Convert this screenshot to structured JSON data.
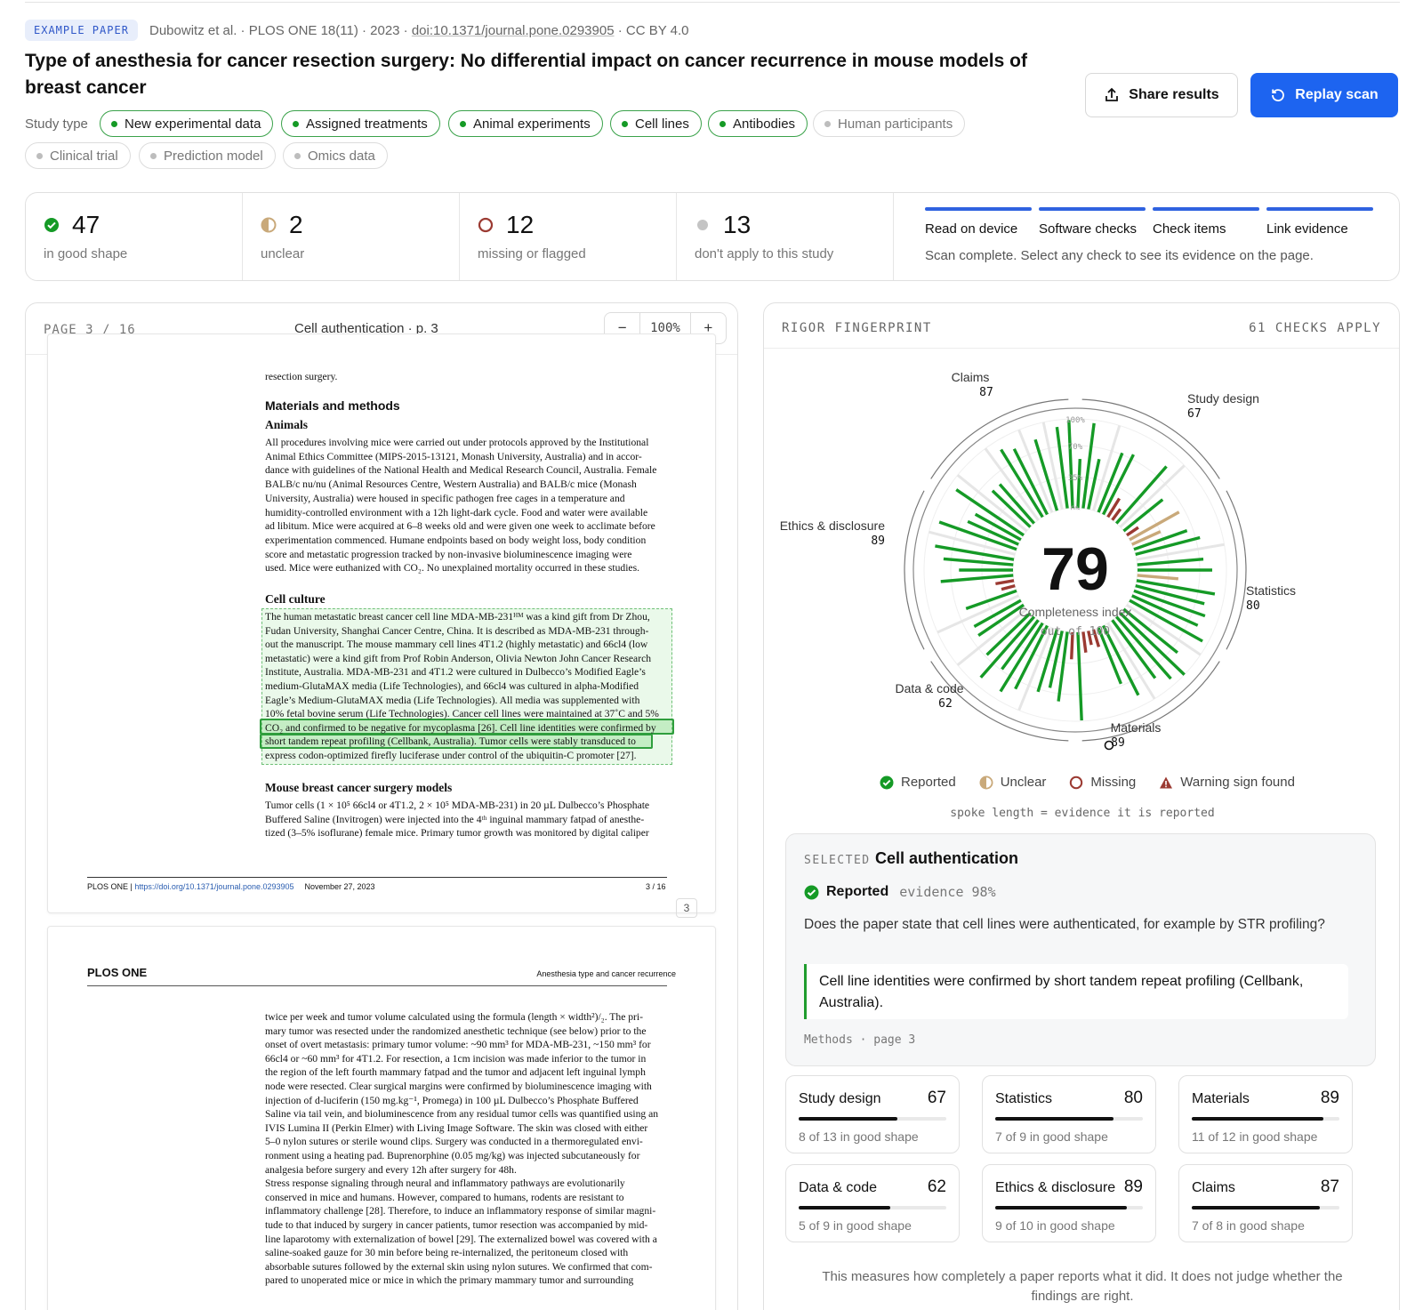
{
  "header": {
    "badge": "EXAMPLE PAPER",
    "meta_prefix": "Dubowitz et al. · PLOS ONE 18(11) · 2023 · ",
    "doi": "doi:10.1371/journal.pone.0293905",
    "meta_suffix": " · CC BY 4.0",
    "title": "Type of anesthesia for cancer resection surgery: No differential impact on cancer recurrence in mouse models of breast cancer",
    "share_label": "Share results",
    "replay_label": "Replay scan",
    "study_type_label": "Study type",
    "chips": [
      {
        "label": "New experimental data",
        "active": true
      },
      {
        "label": "Assigned treatments",
        "active": true
      },
      {
        "label": "Animal experiments",
        "active": true
      },
      {
        "label": "Cell lines",
        "active": true
      },
      {
        "label": "Antibodies",
        "active": true
      },
      {
        "label": "Human participants",
        "active": false
      },
      {
        "label": "Clinical trial",
        "active": false
      },
      {
        "label": "Prediction model",
        "active": false
      },
      {
        "label": "Omics data",
        "active": false
      }
    ]
  },
  "summary": {
    "good": {
      "value": "47",
      "label": "in good shape"
    },
    "unclear": {
      "value": "2",
      "label": "unclear"
    },
    "missing": {
      "value": "12",
      "label": "missing or flagged"
    },
    "na": {
      "value": "13",
      "label": "don't apply to this study"
    },
    "tabs": [
      "Read on device",
      "Software checks",
      "Check items",
      "Link evidence"
    ],
    "message": "Scan complete. Select any check to see its evidence on the page."
  },
  "viewer": {
    "page_indicator": "PAGE 3 / 16",
    "page_title": "Cell authentication · p. 3",
    "zoom_minus": "−",
    "zoom_value": "100%",
    "zoom_plus": "+",
    "page3": {
      "top_fragment": "resection surgery.",
      "h_methods": "Materials and methods",
      "h_animals": "Animals",
      "animals_lines": [
        "All procedures involving mice were carried out under protocols approved by the Institutional",
        "Animal Ethics Committee (MIPS-2015-13121, Monash University, Australia) and in accor-",
        "dance with guidelines of the National Health and Medical Research Council, Australia. Female",
        "BALB/c nu/nu (Animal Resources Centre, Western Australia) and BALB/c mice (Monash",
        "University, Australia) were housed in specific pathogen free cages in a temperature and",
        "humidity-controlled environment with a 12h light-dark cycle. Food and water were available",
        "ad libitum. Mice were acquired at 6–8 weeks old and were given one week to acclimate before",
        "experimentation commenced. Humane endpoints based on body weight loss, body condition",
        "score and metastatic progression tracked by non-invasive bioluminescence imaging were",
        "used. Mice were euthanized with CO₂. No unexplained mortality occurred in these studies."
      ],
      "h_culture": "Cell culture",
      "culture_lines": [
        "The human metastatic breast cancer cell line MDA-MB-231ᴴᴹ was a kind gift from Dr Zhou,",
        "Fudan University, Shanghai Cancer Centre, China. It is described as MDA-MB-231 through-",
        "out the manuscript. The mouse mammary cell lines 4T1.2 (highly metastatic) and 66cl4 (low",
        "metastatic) were a kind gift from Prof Robin Anderson, Olivia Newton John Cancer Research",
        "Institute, Australia. MDA-MB-231 and 4T1.2 were cultured in Dulbecco’s Modified Eagle’s",
        "medium-GlutaMAX media (Life Technologies), and 66cl4 was cultured in alpha-Modified",
        "Eagle’s Medium-GlutaMAX media (Life Technologies). All media was supplemented with",
        "10% fetal bovine serum (Life Technologies). Cancer cell lines were maintained at 37˚C and 5%",
        "CO₂ and confirmed to be negative for mycoplasma [26]. Cell line identities were confirmed by",
        "short tandem repeat profiling (Cellbank, Australia). Tumor cells were stably transduced to",
        "express codon-optimized firefly luciferase under control of the ubiquitin-C promoter [27]."
      ],
      "h_surgery": "Mouse breast cancer surgery models",
      "surgery_lines": [
        "Tumor cells (1 × 10⁵ 66cl4 or 4T1.2, 2 × 10⁵ MDA-MB-231) in 20 µL Dulbecco’s Phosphate",
        "Buffered Saline (Invitrogen) were injected into the 4ᵗʰ inguinal mammary fatpad of anesthe-",
        "tized (3–5% isoflurane) female mice. Primary tumor growth was monitored by digital caliper"
      ],
      "footer_journal": "PLOS ONE | ",
      "footer_link": "https://doi.org/10.1371/journal.pone.0293905",
      "footer_date": "November 27, 2023",
      "footer_page": "3 / 16",
      "page_badge": "3"
    },
    "page4": {
      "journal": "PLOS ONE",
      "running_title": "Anesthesia type and cancer recurrence",
      "lines": [
        "twice per week and tumor volume calculated using the formula (length × width²)/₂. The pri-",
        "mary tumor was resected under the randomized anesthetic technique (see below) prior to the",
        "onset of overt metastasis: primary tumor volume: ~90 mm³ for MDA-MB-231, ~150 mm³ for",
        "66cl4 or ~60 mm³ for 4T1.2. For resection, a 1cm incision was made inferior to the tumor in",
        "the region of the left fourth mammary fatpad and the tumor and adjacent left inguinal lymph",
        "node were resected. Clear surgical margins were confirmed by bioluminescence imaging with",
        "injection of d-luciferin (150 mg.kg⁻¹, Promega) in 100 µL Dulbecco’s Phosphate Buffered",
        "Saline via tail vein, and bioluminescence from any residual tumor cells was quantified using an",
        "IVIS Lumina II (Perkin Elmer) with Living Image Software. The skin was closed with either",
        "5–0 nylon sutures or sterile wound clips. Surgery was conducted in a thermoregulated envi-",
        "ronment using a heating pad. Buprenorphine (0.05 mg/kg) was injected subcutaneously for",
        "analgesia before surgery and every 12h after surgery for 48h.",
        "    Stress response signaling through neural and inflammatory pathways are evolutionarily",
        "conserved in mice and humans. However, compared to humans, rodents are resistant to",
        "inflammatory challenge [28]. Therefore, to induce an inflammatory response of similar magni-",
        "tude to that induced by surgery in cancer patients, tumor resection was accompanied by mid-",
        "line laparotomy with externalization of bowel [29]. The externalized bowel was covered with a",
        "saline-soaked gauze for 30 min before being re-internalized, the peritoneum closed with",
        "absorbable sutures followed by the external skin using nylon sutures. We confirmed that com-",
        "pared to unoperated mice or mice in which the primary mammary tumor and surrounding"
      ]
    }
  },
  "fingerprint": {
    "title": "RIGOR FINGERPRINT",
    "checks_apply": "61 CHECKS APPLY",
    "index_value": "79",
    "index_label": "Completeness index",
    "index_sub": "out of 100",
    "ring_labels": [
      "100%",
      "70%",
      "35%",
      "0%"
    ],
    "categories": [
      {
        "name": "Claims",
        "score": "87",
        "detail": "7 of 8 in good shape",
        "fraction": 0.87
      },
      {
        "name": "Study design",
        "score": "67",
        "detail": "8 of 13 in good shape",
        "fraction": 0.67
      },
      {
        "name": "Statistics",
        "score": "80",
        "detail": "7 of 9 in good shape",
        "fraction": 0.8
      },
      {
        "name": "Materials",
        "score": "89",
        "detail": "11 of 12 in good shape",
        "fraction": 0.89
      },
      {
        "name": "Data & code",
        "score": "62",
        "detail": "5 of 9 in good shape",
        "fraction": 0.62
      },
      {
        "name": "Ethics & disclosure",
        "score": "89",
        "detail": "9 of 10 in good shape",
        "fraction": 0.89
      }
    ],
    "legend": [
      "Reported",
      "Unclear",
      "Missing",
      "Warning sign found"
    ],
    "spoke_note": "spoke length = evidence it is reported",
    "colors": {
      "reported": "#159a26",
      "unclear": "#c9a97a",
      "missing": "#9b3a32",
      "na": "#e6e6e6"
    }
  },
  "selected": {
    "label": "SELECTED",
    "name": "Cell authentication",
    "status": "Reported",
    "evidence": "evidence 98%",
    "question": "Does the paper state that cell lines were authenticated, for example by STR profiling?",
    "quote": "Cell line identities were confirmed by short tandem repeat profiling (Cellbank, Australia).",
    "location": "Methods · page 3"
  },
  "grid": {
    "order": [
      "Study design",
      "Statistics",
      "Materials",
      "Data & code",
      "Ethics & disclosure",
      "Claims"
    ],
    "cards": [
      {
        "name": "Study design",
        "score": "67",
        "detail": "8 of 13 in good shape",
        "fraction": 0.67
      },
      {
        "name": "Statistics",
        "score": "80",
        "detail": "7 of 9 in good shape",
        "fraction": 0.8
      },
      {
        "name": "Materials",
        "score": "89",
        "detail": "11 of 12 in good shape",
        "fraction": 0.89
      },
      {
        "name": "Data & code",
        "score": "62",
        "detail": "5 of 9 in good shape",
        "fraction": 0.62
      },
      {
        "name": "Ethics & disclosure",
        "score": "89",
        "detail": "9 of 10 in good shape",
        "fraction": 0.89
      },
      {
        "name": "Claims",
        "score": "87",
        "detail": "7 of 8 in good shape",
        "fraction": 0.87
      }
    ]
  },
  "footer_note": "This measures how completely a paper reports what it did. It does not judge whether the findings are right."
}
